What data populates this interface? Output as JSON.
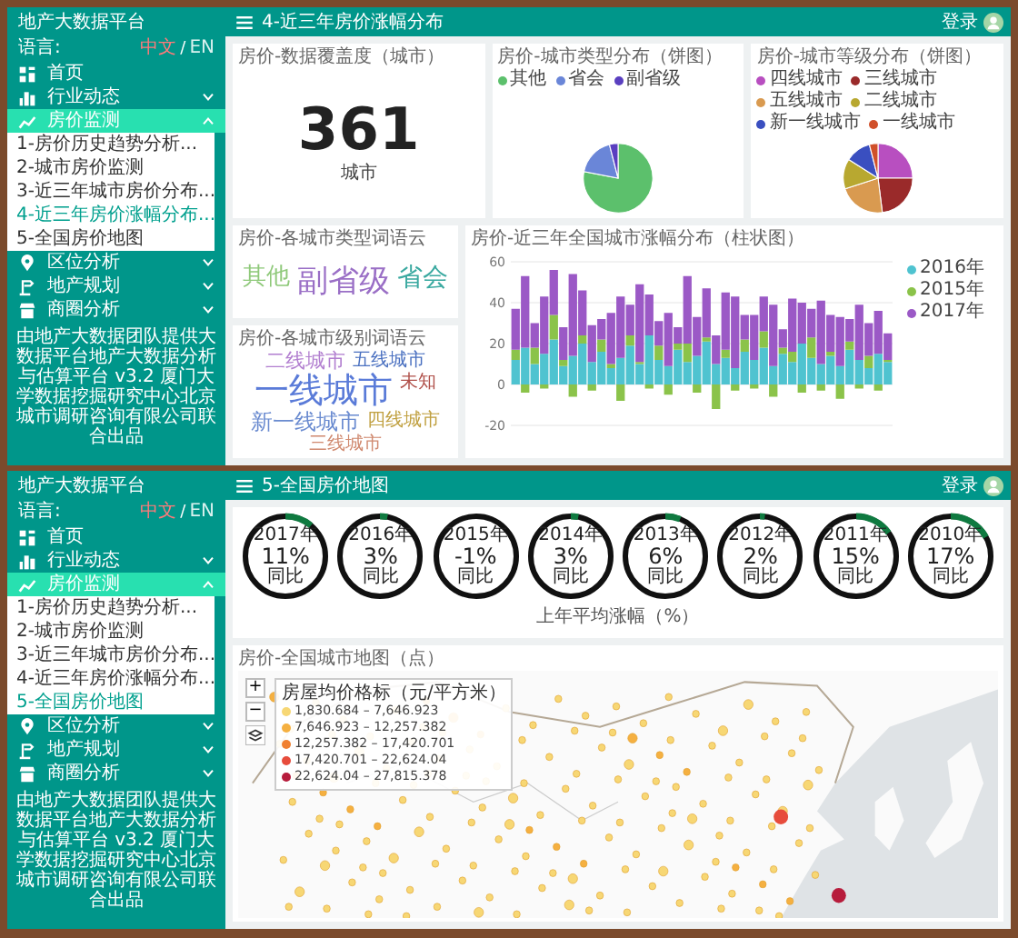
{
  "panels": [
    {
      "kind": "distribution",
      "brand": "地产大数据平台",
      "page_title": "4-近三年房价涨幅分布",
      "login": "登录",
      "sidebar": {
        "language": {
          "label": "语言:",
          "separator": "/",
          "options": [
            {
              "label": "中文",
              "selected": true
            },
            {
              "label": "EN",
              "selected": false
            }
          ]
        },
        "items": [
          {
            "label": "首页",
            "kind": "link",
            "expanded": false
          },
          {
            "label": "行业动态",
            "kind": "group",
            "expanded": false
          },
          {
            "label": "房价监测",
            "kind": "group",
            "expanded": true,
            "children": [
              {
                "label": "1-房价历史趋势分析...",
                "selected": false
              },
              {
                "label": "2-城市房价监测",
                "selected": false
              },
              {
                "label": "3-近三年城市房价分布...",
                "selected": false
              },
              {
                "label": "4-近三年房价涨幅分布...",
                "selected": true
              },
              {
                "label": "5-全国房价地图",
                "selected": false
              }
            ]
          },
          {
            "label": "区位分析",
            "kind": "group",
            "expanded": false
          },
          {
            "label": "地产规划",
            "kind": "group",
            "expanded": false
          },
          {
            "label": "商圈分析",
            "kind": "group",
            "expanded": false
          }
        ],
        "footer": "由地产大数据团队提供大数据平台地产大数据分析与估算平台 v3.2 厦门大学数据挖掘研究中心北京城市调研咨询有限公司联合出品"
      },
      "coverage": {
        "title": "房价-数据覆盖度（城市）",
        "value": "361",
        "unit": "城市"
      },
      "type_pie": {
        "title": "房价-城市类型分布（饼图）",
        "legend": [
          {
            "label": "其他",
            "color": "#5cc06c"
          },
          {
            "label": "省会",
            "color": "#6a86d8"
          },
          {
            "label": "副省级",
            "color": "#5a3fc0"
          }
        ]
      },
      "level_pie": {
        "title": "房价-城市等级分布（饼图）",
        "legend": [
          {
            "label": "四线城市",
            "color": "#b84fc0"
          },
          {
            "label": "三线城市",
            "color": "#9a2a2a"
          },
          {
            "label": "五线城市",
            "color": "#d99a50"
          },
          {
            "label": "二线城市",
            "color": "#b8a830"
          },
          {
            "label": "新一线城市",
            "color": "#3a4fc0"
          },
          {
            "label": "一线城市",
            "color": "#d0502a"
          }
        ]
      },
      "type_cloud": {
        "title": "房价-各城市类型词语云",
        "words": [
          {
            "text": "其他",
            "color": "#8fc97a"
          },
          {
            "text": "副省级",
            "color": "#9a6fc6"
          },
          {
            "text": "省会",
            "color": "#3aa9a0"
          }
        ]
      },
      "level_cloud": {
        "title": "房价-各城市级别词语云",
        "words": [
          {
            "text": "二线城市",
            "color": "#b27fd0"
          },
          {
            "text": "五线城市",
            "color": "#4a70c0"
          },
          {
            "text": "一线城市",
            "color": "#5a7bd8"
          },
          {
            "text": "未知",
            "color": "#b0504a"
          },
          {
            "text": "新一线城市",
            "color": "#6a8bd0"
          },
          {
            "text": "四线城市",
            "color": "#c0a040"
          },
          {
            "text": "三线城市",
            "color": "#d08a70"
          }
        ]
      },
      "growth": {
        "title": "房价-近三年全国城市涨幅分布（柱状图）",
        "chart_data": {
          "type": "bar",
          "stacked": true,
          "grid": true,
          "ylim": [
            -20,
            60
          ],
          "yticks": [
            -20,
            0,
            20,
            40,
            60
          ],
          "series": [
            {
              "name": "2016年",
              "color": "#4fc3d0",
              "values": [
                12,
                18,
                10,
                15,
                22,
                9,
                14,
                20,
                11,
                16,
                8,
                13,
                19,
                10,
                24,
                12,
                9,
                17,
                11,
                14,
                21,
                10,
                13,
                8,
                16,
                12,
                18,
                9,
                15,
                11,
                20,
                13,
                10,
                14,
                9,
                17,
                12,
                8,
                15,
                11
              ]
            },
            {
              "name": "2015年",
              "color": "#8bc34a",
              "values": [
                5,
                -4,
                8,
                -2,
                12,
                3,
                -6,
                4,
                -3,
                6,
                2,
                -8,
                5,
                1,
                -2,
                7,
                -5,
                3,
                9,
                -4,
                2,
                -12,
                4,
                -3,
                6,
                -2,
                8,
                -6,
                3,
                5,
                -4,
                10,
                -3,
                2,
                -7,
                4,
                -2,
                6,
                -3,
                1
              ]
            },
            {
              "name": "2017年",
              "color": "#9b59c6",
              "values": [
                20,
                35,
                12,
                28,
                22,
                16,
                40,
                22,
                18,
                10,
                25,
                30,
                15,
                38,
                20,
                12,
                26,
                8,
                33,
                19,
                24,
                14,
                28,
                35,
                12,
                22,
                17,
                30,
                9,
                26,
                20,
                14,
                31,
                18,
                24,
                11,
                27,
                16,
                21,
                13
              ]
            }
          ]
        }
      }
    },
    {
      "kind": "map",
      "brand": "地产大数据平台",
      "page_title": "5-全国房价地图",
      "login": "登录",
      "sidebar": {
        "language": {
          "label": "语言:",
          "separator": "/",
          "options": [
            {
              "label": "中文",
              "selected": true
            },
            {
              "label": "EN",
              "selected": false
            }
          ]
        },
        "items": [
          {
            "label": "首页",
            "kind": "link",
            "expanded": false
          },
          {
            "label": "行业动态",
            "kind": "group",
            "expanded": false
          },
          {
            "label": "房价监测",
            "kind": "group",
            "expanded": true,
            "children": [
              {
                "label": "1-房价历史趋势分析...",
                "selected": false
              },
              {
                "label": "2-城市房价监测",
                "selected": false
              },
              {
                "label": "3-近三年城市房价分布...",
                "selected": false
              },
              {
                "label": "4-近三年房价涨幅分布...",
                "selected": false
              },
              {
                "label": "5-全国房价地图",
                "selected": true
              }
            ]
          },
          {
            "label": "区位分析",
            "kind": "group",
            "expanded": false
          },
          {
            "label": "地产规划",
            "kind": "group",
            "expanded": false
          },
          {
            "label": "商圈分析",
            "kind": "group",
            "expanded": false
          }
        ],
        "footer": "由地产大数据团队提供大数据平台地产大数据分析与估算平台 v3.2 厦门大学数据挖掘研究中心北京城市调研咨询有限公司联合出品"
      },
      "rings": {
        "caption": "上年平均涨幅（%）",
        "items": [
          {
            "year": "2017年",
            "value": "11%",
            "note": "同比",
            "level": 0.11
          },
          {
            "year": "2016年",
            "value": "3%",
            "note": "同比",
            "level": 0.03
          },
          {
            "year": "2015年",
            "value": "-1%",
            "note": "同比"
          },
          {
            "year": "2014年",
            "value": "3%",
            "note": "同比",
            "level": 0.03
          },
          {
            "year": "2013年",
            "value": "6%",
            "note": "同比",
            "level": 0.06
          },
          {
            "year": "2012年",
            "value": "2%",
            "note": "同比",
            "level": 0.02
          },
          {
            "year": "2011年",
            "value": "15%",
            "note": "同比",
            "level": 0.15
          },
          {
            "year": "2010年",
            "value": "17%",
            "note": "同比",
            "level": 0.17
          }
        ]
      },
      "map": {
        "title": "房价-全国城市地图（点）",
        "zoom_controls": [
          "+",
          "−"
        ],
        "legend": {
          "title": "房屋均价格标（元/平方米）",
          "entries": [
            {
              "label": "1,830.684 – 7,646.923",
              "color": "#f7d774"
            },
            {
              "label": "7,646.923 – 12,257.382",
              "color": "#f5b041"
            },
            {
              "label": "12,257.382 – 17,420.701",
              "color": "#f08030"
            },
            {
              "label": "17,420.701 – 22,624.04",
              "color": "#e74c3c"
            },
            {
              "label": "22,624.04 – 27,815.378",
              "color": "#b71c3c"
            }
          ]
        }
      }
    }
  ]
}
